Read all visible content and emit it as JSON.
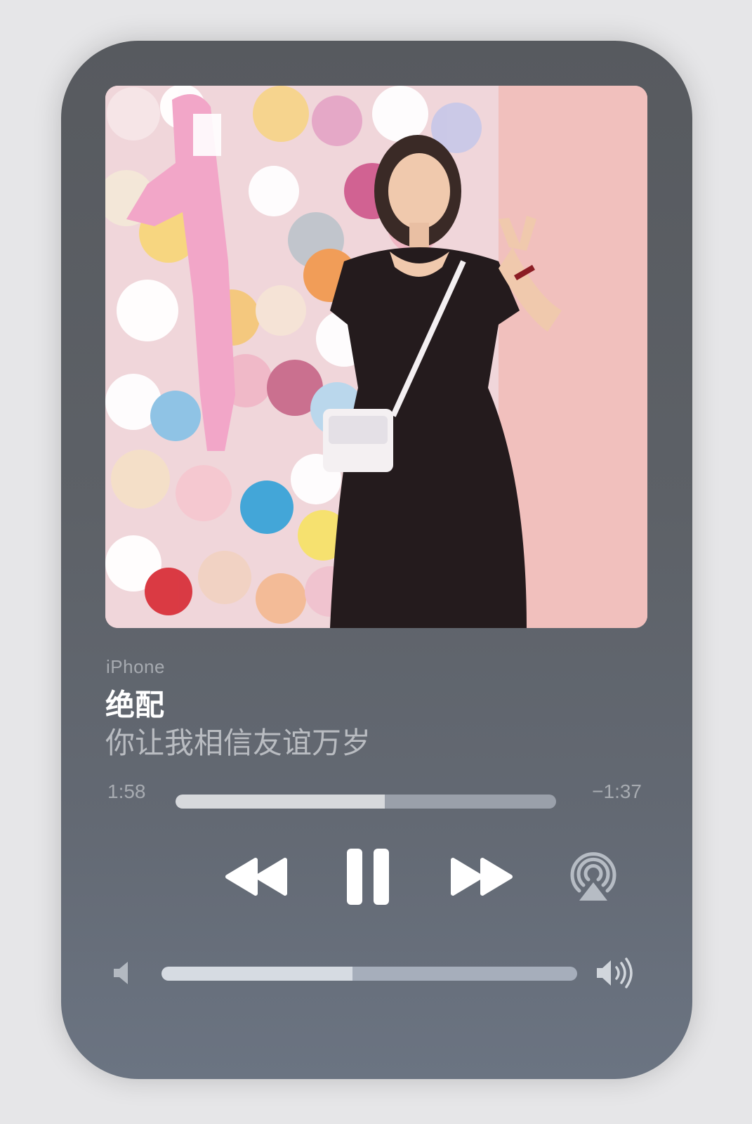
{
  "player": {
    "source": "iPhone",
    "title": "绝配",
    "subtitle": "你让我相信友谊万岁",
    "time_elapsed": "1:58",
    "time_remaining": "−1:37",
    "progress": 0.55,
    "volume": 0.46
  },
  "controls": {
    "rewind_icon": "rewind-icon",
    "pause_icon": "pause-icon",
    "forward_icon": "fast-forward-icon",
    "airplay_icon": "airplay-icon",
    "volume_low_icon": "speaker-low-icon",
    "volume_high_icon": "speaker-high-icon"
  },
  "colors": {
    "title": "#ffffff",
    "secondary_text": "#a7abb1",
    "progress_fill": "#d7d9dc",
    "progress_track": "#9aa0aa"
  }
}
